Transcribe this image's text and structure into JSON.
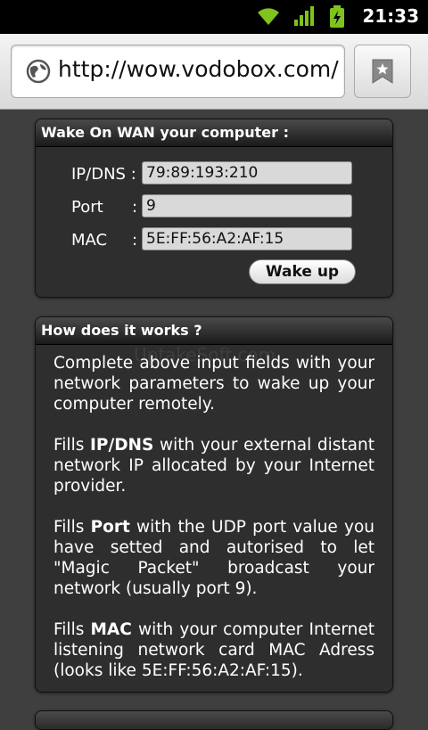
{
  "status": {
    "time": "21:33"
  },
  "browser": {
    "url": "http://wow.vodobox.com/"
  },
  "wake_panel": {
    "title": "Wake On WAN your computer :",
    "ip_label": "IP/DNS :",
    "ip_value": "79:89:193:210",
    "port_label": "Port",
    "port_value": "9",
    "mac_label": "MAC",
    "mac_value": "5E:FF:56:A2:AF:15",
    "colon": ":",
    "button_label": "Wake up"
  },
  "help_panel": {
    "title": "How does it works ?",
    "para1": "Complete above input fields with your network parameters to wake up your computer remotely.",
    "para2_pre": "Fills ",
    "para2_bold": "IP/DNS",
    "para2_post": " with your external distant network IP allocated by your Internet provider.",
    "para3_pre": "Fills ",
    "para3_bold": "Port",
    "para3_post": " with the UDP port value you have setted and autorised to let \"Magic Packet\" broadcast your network (usually port 9).",
    "para4_pre": "Fills ",
    "para4_bold": "MAC",
    "para4_post": " with your computer Internet listening network card MAC Adress (looks like 5E:FF:56:A2:AF:15)."
  },
  "watermark": "UptakeSoft.com",
  "colors": {
    "panel": "#2e2e2e",
    "background": "#3f3f3f",
    "wifi": "#7fc31c"
  }
}
